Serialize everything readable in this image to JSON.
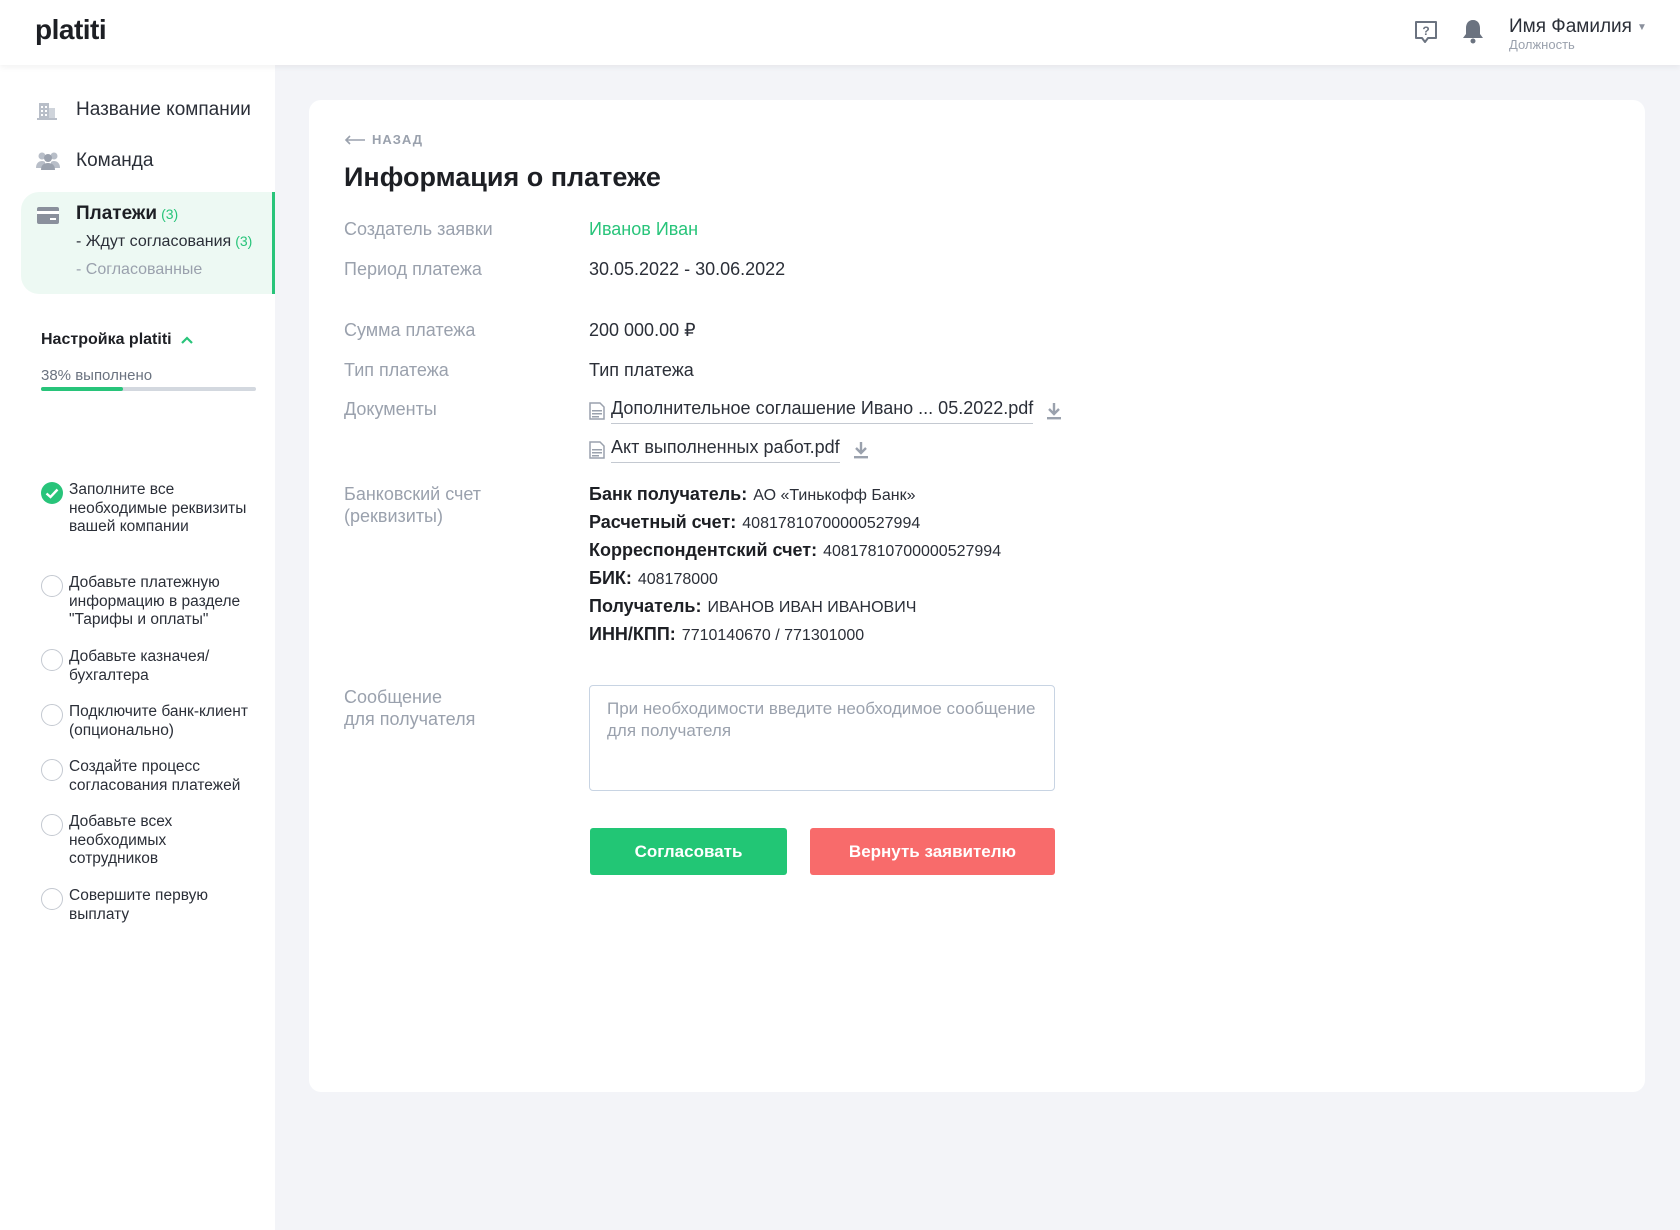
{
  "header": {
    "logo": "platiti",
    "user_name": "Имя Фамилия",
    "user_role": "Должность"
  },
  "sidebar": {
    "items": [
      {
        "label": "Название компании",
        "icon": "building-icon"
      },
      {
        "label": "Команда",
        "icon": "team-icon"
      }
    ],
    "payments": {
      "label": "Платежи",
      "count": "(3)",
      "sub_pending": "- Ждут согласования",
      "sub_pending_count": "(3)",
      "sub_approved": "- Согласованные"
    },
    "setup": {
      "title": "Настройка platiti",
      "progress_text": "38% выполнено",
      "progress": 0.38,
      "steps": [
        {
          "label": "Заполните все необходимые реквизиты вашей компании",
          "done": true
        },
        {
          "label": "Добавьте платежную информацию в разделе \"Тарифы и оплаты\"",
          "done": false
        },
        {
          "label": "Добавьте казначея/ бухгалтера",
          "done": false
        },
        {
          "label": "Подключите банк-клиент (опционально)",
          "done": false
        },
        {
          "label": "Создайте процесс согласования платежей",
          "done": false
        },
        {
          "label": "Добавьте всех необходимых сотрудников",
          "done": false
        },
        {
          "label": "Совершите первую выплату",
          "done": false
        }
      ]
    }
  },
  "main": {
    "back": "НАЗАД",
    "title": "Информация о платеже",
    "fields": {
      "creator_label": "Создатель заявки",
      "creator_value": "Иванов Иван",
      "period_label": "Период платежа",
      "period_value": "30.05.2022 - 30.06.2022",
      "amount_label": "Сумма платежа",
      "amount_value": "200 000.00  ₽",
      "type_label": "Тип платежа",
      "type_value": "Тип платежа",
      "docs_label": "Документы",
      "docs": [
        "Дополнительное соглашение Ивано ... 05.2022.pdf",
        "Акт выполненных работ.pdf"
      ],
      "bank_label_1": "Банковский счет",
      "bank_label_2": "(реквизиты)",
      "bank": [
        {
          "k": "Банк получатель:",
          "v": "АО «Тинькофф Банк»"
        },
        {
          "k": "Расчетный счет:",
          "v": "40817810700000527994"
        },
        {
          "k": "Корреспондентский счет:",
          "v": "40817810700000527994"
        },
        {
          "k": "БИК:",
          "v": "408178000"
        },
        {
          "k": "Получатель:",
          "v": "ИВАНОВ ИВАН ИВАНОВИЧ"
        },
        {
          "k": "ИНН/КПП:",
          "v": "7710140670 / 771301000"
        }
      ],
      "message_label_1": "Сообщение",
      "message_label_2": "для получателя",
      "message_placeholder": "При необходимости введите необходимое сообщение для получателя",
      "message_value": ""
    },
    "buttons": {
      "approve": "Согласовать",
      "return": "Вернуть заявителю"
    }
  },
  "colors": {
    "accent": "#28c47a",
    "danger": "#f86b6b",
    "muted": "#9aa1ad"
  }
}
